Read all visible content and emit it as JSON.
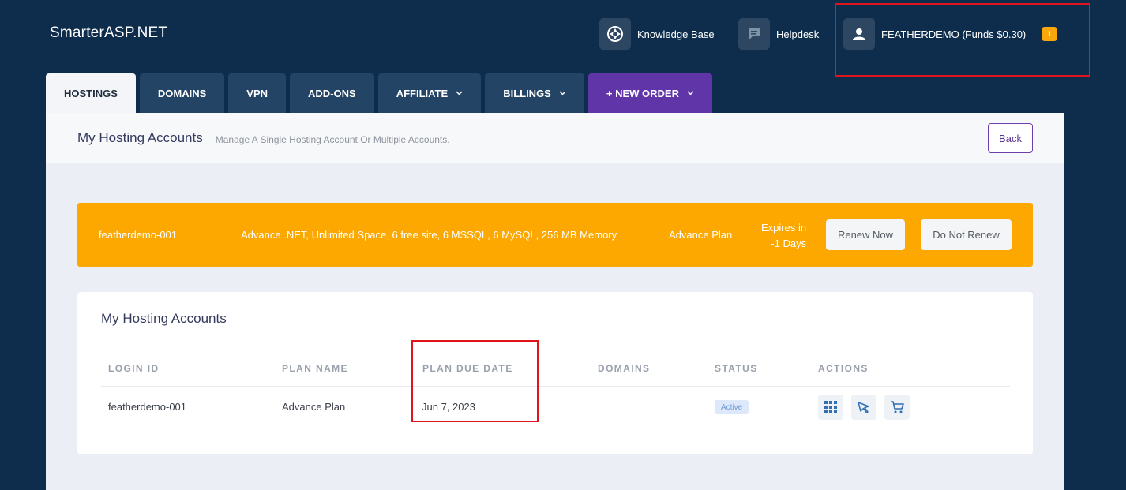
{
  "brand": "SmarterASP.NET",
  "topbar": {
    "knowledge_base": "Knowledge Base",
    "helpdesk": "Helpdesk",
    "account": "FEATHERDEMO (Funds $0.30)",
    "badge": "1"
  },
  "tabs": [
    {
      "label": "HOSTINGS"
    },
    {
      "label": "DOMAINS"
    },
    {
      "label": "VPN"
    },
    {
      "label": "ADD-ONS"
    },
    {
      "label": "AFFILIATE"
    },
    {
      "label": "BILLINGS"
    },
    {
      "label": "+ NEW ORDER"
    }
  ],
  "header": {
    "title": "My Hosting Accounts",
    "subtitle": "Manage A Single Hosting Account Or Multiple Accounts.",
    "back": "Back"
  },
  "alert": {
    "login": "featherdemo-001",
    "description": "Advance .NET, Unlimited Space, 6 free site, 6 MSSQL, 6 MySQL, 256 MB Memory",
    "plan": "Advance Plan",
    "expires_line1": "Expires in",
    "expires_line2": "-1 Days",
    "renew": "Renew Now",
    "no_renew": "Do Not Renew"
  },
  "table": {
    "title": "My Hosting Accounts",
    "columns": [
      "LOGIN ID",
      "PLAN NAME",
      "PLAN DUE DATE",
      "DOMAINS",
      "STATUS",
      "ACTIONS"
    ],
    "rows": [
      {
        "login_id": "featherdemo-001",
        "plan_name": "Advance Plan",
        "due_date": "Jun 7, 2023",
        "domains": "",
        "status": "Active"
      }
    ]
  },
  "colors": {
    "background": "#0e2d4c",
    "tab": "#244466",
    "new_order": "#5f35a7",
    "alert": "#fca800",
    "highlight": "#e0141d"
  },
  "icons": [
    "knowledge-base-icon",
    "helpdesk-icon",
    "user-icon",
    "chevron-down-icon",
    "grid-icon",
    "rocket-icon",
    "cart-icon"
  ]
}
